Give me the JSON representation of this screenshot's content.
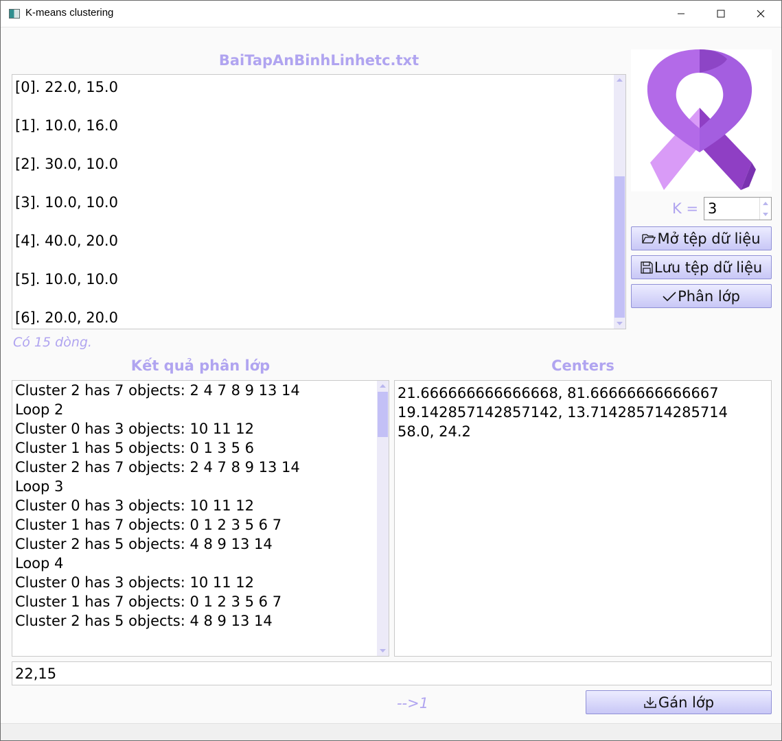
{
  "window": {
    "title": "K-means clustering"
  },
  "data_panel": {
    "file_name": "BaiTapAnBinhLinhetc.txt",
    "lines": [
      "[0]. 22.0, 15.0",
      "[1]. 10.0, 16.0",
      "[2]. 30.0, 10.0",
      "[3]. 10.0, 10.0",
      "[4]. 40.0, 20.0",
      "[5]. 10.0, 10.0",
      "[6]. 20.0, 20.0"
    ],
    "row_count_text": "Có 15 dòng."
  },
  "controls": {
    "k_label": "K =",
    "k_value": "3",
    "open_label": "Mở tệp dữ liệu",
    "save_label": "Lưu tệp dữ liệu",
    "classify_label": "Phân lớp",
    "assign_label": "Gán lớp"
  },
  "results": {
    "title": "Kết quả phân lớp",
    "lines": [
      "Cluster 2 has 7 objects:  2 4 7 8 9 13 14",
      "Loop 2",
      "Cluster 0 has 3 objects:  10 11 12",
      "Cluster 1 has 5 objects:  0 1 3 5 6",
      "Cluster 2 has 7 objects:  2 4 7 8 9 13 14",
      "Loop 3",
      "Cluster 0 has 3 objects:  10 11 12",
      "Cluster 1 has 7 objects:  0 1 2 3 5 6 7",
      "Cluster 2 has 5 objects:  4 8 9 13 14",
      "Loop 4",
      "Cluster 0 has 3 objects:  10 11 12",
      "Cluster 1 has 7 objects:  0 1 2 3 5 6 7",
      "Cluster 2 has 5 objects:  4 8 9 13 14"
    ]
  },
  "centers": {
    "title": "Centers",
    "lines": [
      "21.666666666666668, 81.66666666666667",
      "19.142857142857142, 13.714285714285714",
      "58.0, 24.2"
    ]
  },
  "predict": {
    "input_value": "22,15",
    "result_text": "-->1"
  },
  "colors": {
    "accent": "#b0a4f0",
    "button_top": "#ececff",
    "button_bottom": "#c8c7f6",
    "ribbon_purple": "#a45ee0"
  },
  "icons": [
    "folder-open-icon",
    "save-icon",
    "check-icon",
    "download-icon",
    "ribbon-logo"
  ]
}
